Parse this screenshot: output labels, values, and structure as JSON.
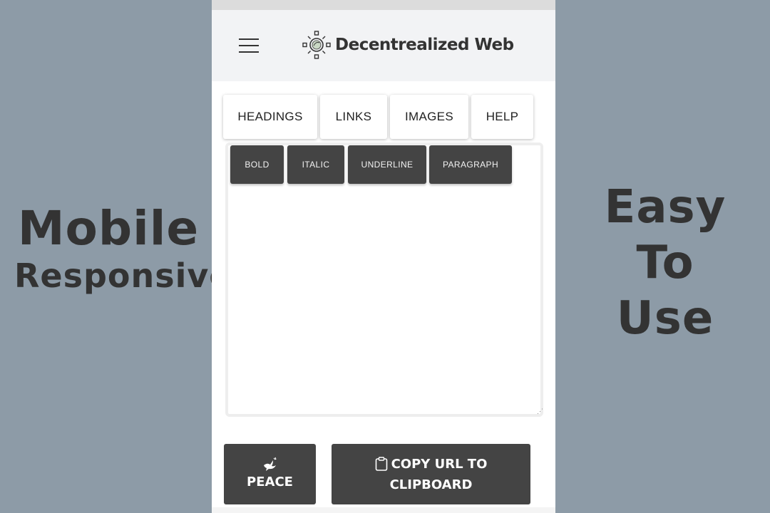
{
  "promo": {
    "left_line1": "Mobile",
    "left_line2": "Responsive",
    "right_line1": "Easy",
    "right_line2": "To",
    "right_line3": "Use"
  },
  "header": {
    "title": "Decentrealized Web",
    "menu_icon": "hamburger-menu-icon",
    "logo_icon": "sun-lens-logo-icon"
  },
  "tabs": [
    {
      "label": "HEADINGS"
    },
    {
      "label": "LINKS"
    },
    {
      "label": "IMAGES"
    },
    {
      "label": "HELP"
    }
  ],
  "format_buttons": [
    {
      "label": "BOLD"
    },
    {
      "label": "ITALIC"
    },
    {
      "label": "UNDERLINE"
    },
    {
      "label": "PARAGRAPH"
    }
  ],
  "editor": {
    "value": ""
  },
  "actions": {
    "peace_label": "PEACE",
    "peace_icon": "dove-icon",
    "copy_line1": "COPY URL TO",
    "copy_line2": "CLIPBOARD",
    "copy_icon": "clipboard-icon"
  },
  "colors": {
    "background": "#8d9ba7",
    "button_dark": "#444444",
    "header_bg": "#f2f3f5"
  }
}
